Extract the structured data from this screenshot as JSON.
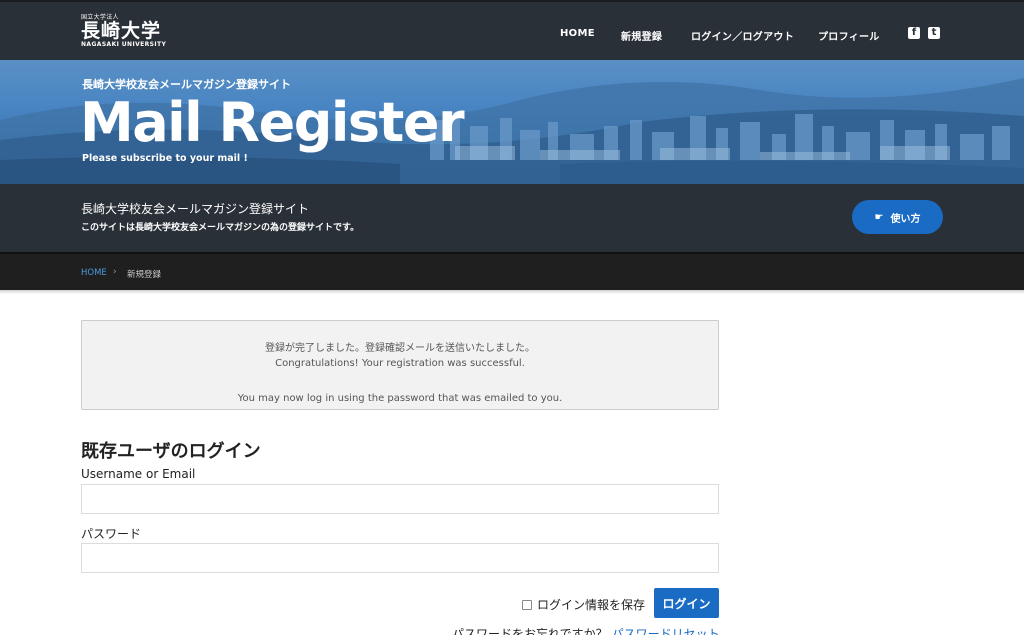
{
  "nav": {
    "logo_small": "国立大学法人",
    "logo_kanji": "長崎大学",
    "logo_en": "NAGASAKI UNIVERSITY",
    "items": [
      {
        "label": "HOME"
      },
      {
        "label": "新規登録"
      },
      {
        "label": "ログイン／ログアウト"
      },
      {
        "label": "プロフィール"
      }
    ],
    "facebook_glyph": "f",
    "twitter_glyph": "t"
  },
  "hero": {
    "subtitle": "長崎大学校友会メールマガジン登録サイト",
    "title": "Mail Register",
    "caption": "Please subscribe to your mail !"
  },
  "band": {
    "title": "長崎大学校友会メールマガジン登録サイト",
    "description": "このサイトは長崎大学校友会メールマガジンの為の登録サイトです。",
    "howto_label": "使い方",
    "howto_icon": "☛"
  },
  "breadcrumb": {
    "home": "HOME",
    "separator": "›",
    "current": "新規登録"
  },
  "notice": {
    "line1": "登録が完了しました。登録確認メールを送信いたしました。",
    "line2": "Congratulations! Your registration was successful.",
    "line3": "You may now log in using the password that was emailed to you."
  },
  "login": {
    "heading": "既存ユーザのログイン",
    "username_label": "Username or Email",
    "username_value": "",
    "password_label": "パスワード",
    "password_value": "",
    "remember_label": "ログイン情報を保存",
    "remember_checked": false,
    "submit_label": "ログイン",
    "forgot_text": "パスワードをお忘れですか？",
    "reset_link": "パスワードリセット"
  },
  "colors": {
    "nav_bg": "#2a3038",
    "accent": "#1a6bc4",
    "breadcrumb_bg": "#1f1f1f"
  }
}
